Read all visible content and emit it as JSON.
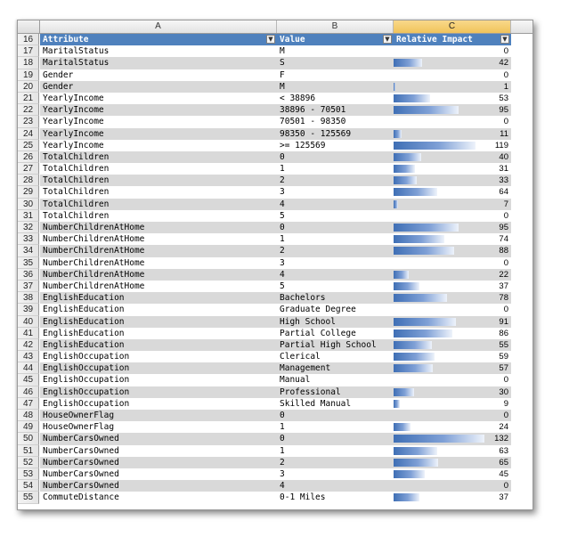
{
  "columns": [
    "A",
    "B",
    "C"
  ],
  "header_row": {
    "row": "16",
    "attribute": "Attribute",
    "value": "Value",
    "impact": "Relative Impact",
    "dropdown_glyph": "▼"
  },
  "max_impact": 132,
  "bar_color": "#4f81bd",
  "rows": [
    {
      "row": "17",
      "attribute": "MaritalStatus",
      "value": "M",
      "impact": 0
    },
    {
      "row": "18",
      "attribute": "MaritalStatus",
      "value": "S",
      "impact": 42
    },
    {
      "row": "19",
      "attribute": "Gender",
      "value": "F",
      "impact": 0
    },
    {
      "row": "20",
      "attribute": "Gender",
      "value": "M",
      "impact": 1
    },
    {
      "row": "21",
      "attribute": "YearlyIncome",
      "value": "< 38896",
      "impact": 53
    },
    {
      "row": "22",
      "attribute": "YearlyIncome",
      "value": "38896 - 70501",
      "impact": 95
    },
    {
      "row": "23",
      "attribute": "YearlyIncome",
      "value": "70501 - 98350",
      "impact": 0
    },
    {
      "row": "24",
      "attribute": "YearlyIncome",
      "value": "98350 - 125569",
      "impact": 11
    },
    {
      "row": "25",
      "attribute": "YearlyIncome",
      "value": ">= 125569",
      "impact": 119
    },
    {
      "row": "26",
      "attribute": "TotalChildren",
      "value": "0",
      "impact": 40
    },
    {
      "row": "27",
      "attribute": "TotalChildren",
      "value": "1",
      "impact": 31
    },
    {
      "row": "28",
      "attribute": "TotalChildren",
      "value": "2",
      "impact": 33
    },
    {
      "row": "29",
      "attribute": "TotalChildren",
      "value": "3",
      "impact": 64
    },
    {
      "row": "30",
      "attribute": "TotalChildren",
      "value": "4",
      "impact": 7
    },
    {
      "row": "31",
      "attribute": "TotalChildren",
      "value": "5",
      "impact": 0
    },
    {
      "row": "32",
      "attribute": "NumberChildrenAtHome",
      "value": "0",
      "impact": 95
    },
    {
      "row": "33",
      "attribute": "NumberChildrenAtHome",
      "value": "1",
      "impact": 74
    },
    {
      "row": "34",
      "attribute": "NumberChildrenAtHome",
      "value": "2",
      "impact": 88
    },
    {
      "row": "35",
      "attribute": "NumberChildrenAtHome",
      "value": "3",
      "impact": 0
    },
    {
      "row": "36",
      "attribute": "NumberChildrenAtHome",
      "value": "4",
      "impact": 22
    },
    {
      "row": "37",
      "attribute": "NumberChildrenAtHome",
      "value": "5",
      "impact": 37
    },
    {
      "row": "38",
      "attribute": "EnglishEducation",
      "value": "Bachelors",
      "impact": 78
    },
    {
      "row": "39",
      "attribute": "EnglishEducation",
      "value": "Graduate Degree",
      "impact": 0
    },
    {
      "row": "40",
      "attribute": "EnglishEducation",
      "value": "High School",
      "impact": 91
    },
    {
      "row": "41",
      "attribute": "EnglishEducation",
      "value": "Partial College",
      "impact": 86
    },
    {
      "row": "42",
      "attribute": "EnglishEducation",
      "value": "Partial High School",
      "impact": 55
    },
    {
      "row": "43",
      "attribute": "EnglishOccupation",
      "value": "Clerical",
      "impact": 59
    },
    {
      "row": "44",
      "attribute": "EnglishOccupation",
      "value": "Management",
      "impact": 57
    },
    {
      "row": "45",
      "attribute": "EnglishOccupation",
      "value": "Manual",
      "impact": 0
    },
    {
      "row": "46",
      "attribute": "EnglishOccupation",
      "value": "Professional",
      "impact": 30
    },
    {
      "row": "47",
      "attribute": "EnglishOccupation",
      "value": "Skilled Manual",
      "impact": 9
    },
    {
      "row": "48",
      "attribute": "HouseOwnerFlag",
      "value": "0",
      "impact": 0
    },
    {
      "row": "49",
      "attribute": "HouseOwnerFlag",
      "value": "1",
      "impact": 24
    },
    {
      "row": "50",
      "attribute": "NumberCarsOwned",
      "value": "0",
      "impact": 132
    },
    {
      "row": "51",
      "attribute": "NumberCarsOwned",
      "value": "1",
      "impact": 63
    },
    {
      "row": "52",
      "attribute": "NumberCarsOwned",
      "value": "2",
      "impact": 65
    },
    {
      "row": "53",
      "attribute": "NumberCarsOwned",
      "value": "3",
      "impact": 45
    },
    {
      "row": "54",
      "attribute": "NumberCarsOwned",
      "value": "4",
      "impact": 0
    },
    {
      "row": "55",
      "attribute": "CommuteDistance",
      "value": "0-1 Miles",
      "impact": 37
    }
  ]
}
